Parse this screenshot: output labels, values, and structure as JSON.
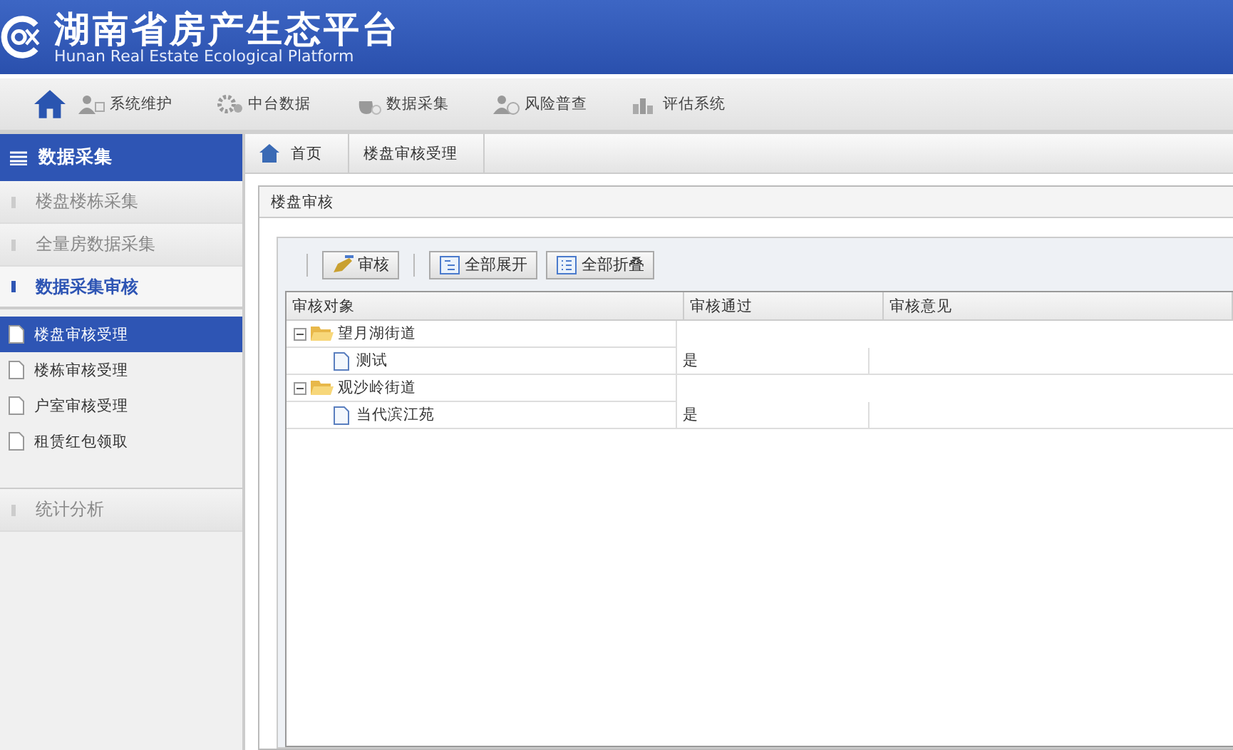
{
  "header": {
    "title": "湖南省房产生态平台",
    "subtitle": "Hunan Real Estate Ecological Platform"
  },
  "nav": [
    {
      "label": "系统维护"
    },
    {
      "label": "中台数据"
    },
    {
      "label": "数据采集"
    },
    {
      "label": "风险普查"
    },
    {
      "label": "评估系统"
    }
  ],
  "sidebar": {
    "title": "数据采集",
    "groups": [
      {
        "label": "楼盘楼栋采集",
        "selected": false
      },
      {
        "label": "全量房数据采集",
        "selected": false
      },
      {
        "label": "数据采集审核",
        "selected": true,
        "items": [
          {
            "label": "楼盘审核受理",
            "selected": true
          },
          {
            "label": "楼栋审核受理",
            "selected": false
          },
          {
            "label": "户室审核受理",
            "selected": false
          },
          {
            "label": "租赁红包领取",
            "selected": false
          }
        ]
      },
      {
        "label": "统计分析",
        "selected": false
      }
    ]
  },
  "breadcrumb": [
    "首页",
    "楼盘审核受理"
  ],
  "panel": {
    "title": "楼盘审核",
    "toolbar": [
      {
        "label": "审核"
      },
      {
        "label": "全部展开"
      },
      {
        "label": "全部折叠"
      }
    ],
    "table": {
      "columns": [
        "审核对象",
        "审核通过",
        "审核意见"
      ],
      "rows": [
        {
          "name": "望月湖街道",
          "expanded": true,
          "children": [
            {
              "name": "测试",
              "passed": "是"
            }
          ]
        },
        {
          "name": "观沙岭街道",
          "expanded": true,
          "children": [
            {
              "name": "当代滨江苑",
              "passed": "是"
            }
          ]
        }
      ]
    }
  }
}
